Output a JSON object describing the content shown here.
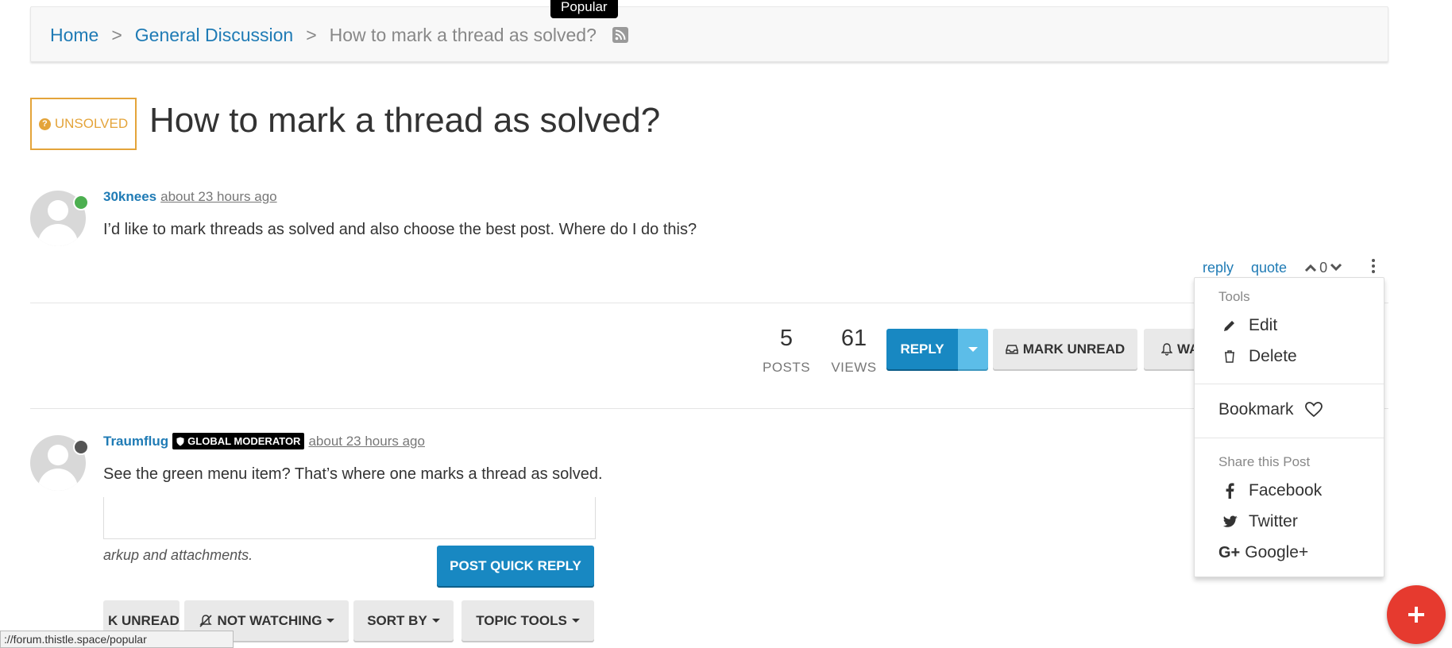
{
  "breadcrumb": {
    "home": "Home",
    "sep": ">",
    "category": "General Discussion",
    "current": "How to mark a thread as solved?"
  },
  "tooltip": "Popular",
  "topic": {
    "badge": "UNSOLVED",
    "title": "How to mark a thread as solved?"
  },
  "post1": {
    "author": "30knees",
    "time": "about 23 hours ago",
    "text": "I’d like to mark threads as solved and also choose the best post. Where do I do this?",
    "status_color": "#4caf50",
    "actions": {
      "reply": "reply",
      "quote": "quote",
      "votes": "0"
    }
  },
  "stats": {
    "posts_count": "5",
    "posts_label": "POSTS",
    "views_count": "61",
    "views_label": "VIEWS"
  },
  "toolbar": {
    "reply": "REPLY",
    "mark_unread": "MARK UNREAD",
    "watching_partial": "WA"
  },
  "dropdown": {
    "tools_header": "Tools",
    "edit": "Edit",
    "delete": "Delete",
    "bookmark": "Bookmark",
    "share_header": "Share this Post",
    "facebook": "Facebook",
    "twitter": "Twitter",
    "google": "Google+"
  },
  "post2": {
    "author": "Traumflug",
    "badge": "GLOBAL MODERATOR",
    "time": "about 23 hours ago",
    "text": "See the green menu item? That’s where one marks a thread as solved.",
    "status_color": "#555555"
  },
  "composer": {
    "hint": "arkup and attachments.",
    "post_quick_reply": "POST QUICK REPLY"
  },
  "bottom_toolbar": {
    "mark_unread_partial": "K UNREAD",
    "not_watching": "NOT WATCHING",
    "sort_by": "SORT BY",
    "topic_tools": "TOPIC TOOLS"
  },
  "status_bar": "://forum.thistle.space/popular",
  "colors": {
    "accent": "#1888c2",
    "link": "#1f7bb5",
    "unsolved": "#e4a43a",
    "fab": "#e63a2f"
  }
}
